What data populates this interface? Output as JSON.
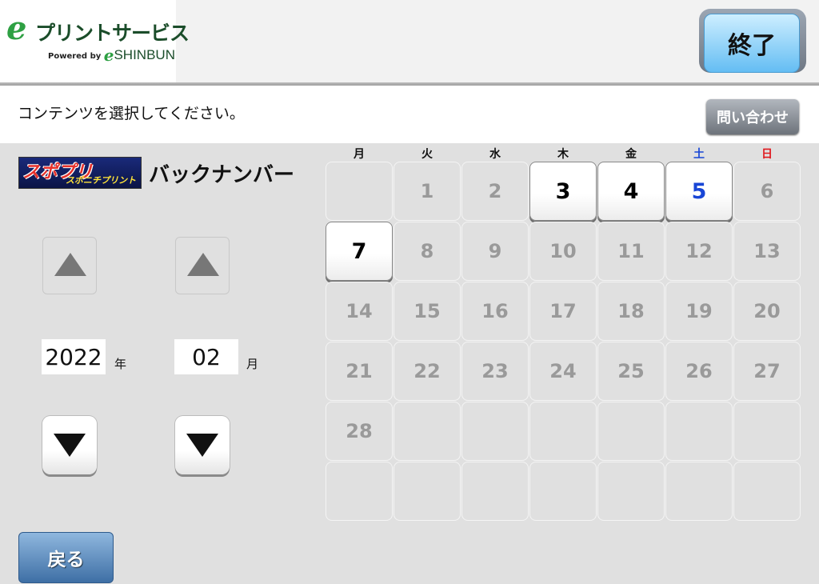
{
  "header": {
    "logo_main": "プリントサービス",
    "logo_powered": "Powered by",
    "logo_shinbun": "SHINBUN",
    "end_label": "終了"
  },
  "instruction": {
    "text": "コンテンツを選択してください。",
    "inquiry_label": "問い合わせ"
  },
  "brand": {
    "logo_text_main": "スポプリ",
    "logo_text_sub": "スポニチプリント",
    "title": "バックナンバー"
  },
  "selector": {
    "year_value": "2022",
    "year_unit": "年",
    "month_value": "02",
    "month_unit": "月"
  },
  "calendar": {
    "weekdays": [
      "月",
      "火",
      "水",
      "木",
      "金",
      "土",
      "日"
    ],
    "cells": [
      {
        "label": "",
        "active": false
      },
      {
        "label": "1",
        "active": false
      },
      {
        "label": "2",
        "active": false
      },
      {
        "label": "3",
        "active": true
      },
      {
        "label": "4",
        "active": true
      },
      {
        "label": "5",
        "active": true
      },
      {
        "label": "6",
        "active": false
      },
      {
        "label": "7",
        "active": true
      },
      {
        "label": "8",
        "active": false
      },
      {
        "label": "9",
        "active": false
      },
      {
        "label": "10",
        "active": false
      },
      {
        "label": "11",
        "active": false
      },
      {
        "label": "12",
        "active": false
      },
      {
        "label": "13",
        "active": false
      },
      {
        "label": "14",
        "active": false
      },
      {
        "label": "15",
        "active": false
      },
      {
        "label": "16",
        "active": false
      },
      {
        "label": "17",
        "active": false
      },
      {
        "label": "18",
        "active": false
      },
      {
        "label": "19",
        "active": false
      },
      {
        "label": "20",
        "active": false
      },
      {
        "label": "21",
        "active": false
      },
      {
        "label": "22",
        "active": false
      },
      {
        "label": "23",
        "active": false
      },
      {
        "label": "24",
        "active": false
      },
      {
        "label": "25",
        "active": false
      },
      {
        "label": "26",
        "active": false
      },
      {
        "label": "27",
        "active": false
      },
      {
        "label": "28",
        "active": false
      },
      {
        "label": "",
        "active": false
      },
      {
        "label": "",
        "active": false
      },
      {
        "label": "",
        "active": false
      },
      {
        "label": "",
        "active": false
      },
      {
        "label": "",
        "active": false
      },
      {
        "label": "",
        "active": false
      },
      {
        "label": "",
        "active": false
      },
      {
        "label": "",
        "active": false
      },
      {
        "label": "",
        "active": false
      },
      {
        "label": "",
        "active": false
      },
      {
        "label": "",
        "active": false
      },
      {
        "label": "",
        "active": false
      },
      {
        "label": "",
        "active": false
      }
    ]
  },
  "footer": {
    "back_label": "戻る"
  },
  "colors": {
    "saturday": "#1846d6",
    "sunday": "#e0191e",
    "brand_green": "#2ea043",
    "end_button": "#64bdf3",
    "back_button": "#3e6fa5"
  }
}
